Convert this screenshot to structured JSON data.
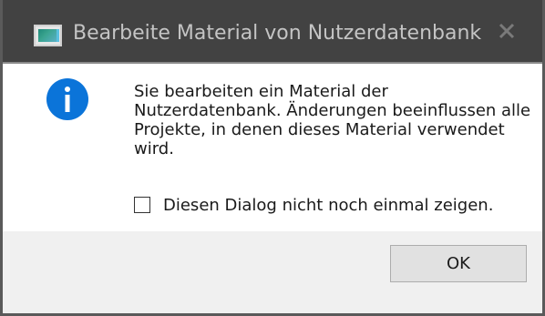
{
  "window": {
    "title": "Bearbeite Material von Nutzerdatenbank",
    "app_icon": "app-window-icon",
    "close_icon": "close-icon"
  },
  "dialog": {
    "icon": "info-icon",
    "message": "Sie bearbeiten ein Material der Nutzerdatenbank. Änderungen beeinflussen alle Projekte, in denen dieses Material verwendet wird.",
    "checkbox_label": "Diesen Dialog nicht noch einmal zeigen.",
    "checkbox_checked": false,
    "ok_label": "OK"
  },
  "colors": {
    "titlebar_bg": "#424242",
    "title_text": "#c4c4c4",
    "info_blue": "#0b74d9",
    "footer_bg": "#f0f0f0",
    "button_bg": "#e1e1e1"
  }
}
